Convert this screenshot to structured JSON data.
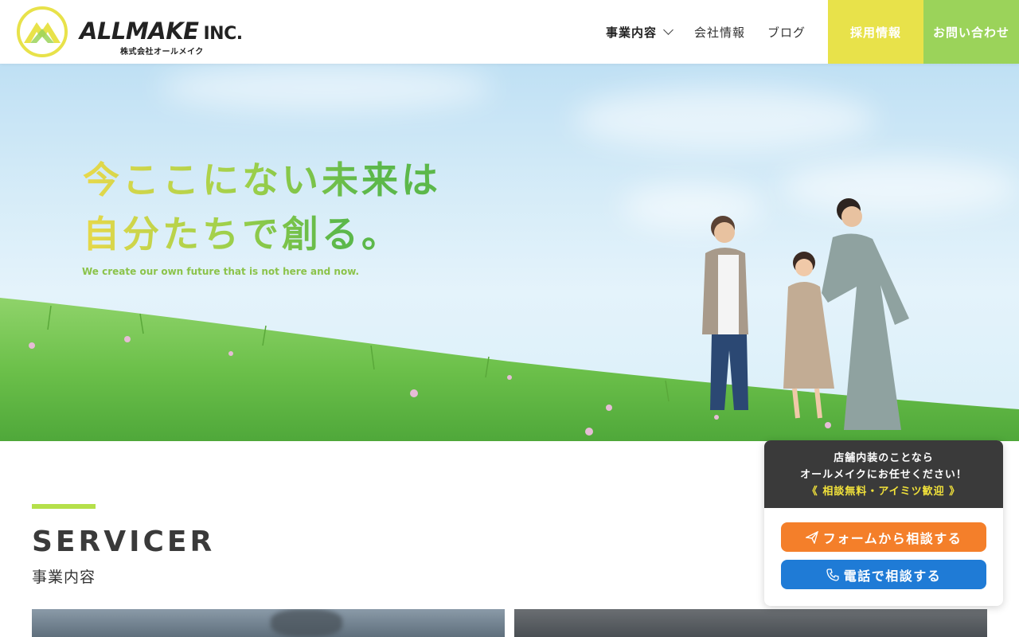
{
  "header": {
    "logo_word": "ALLMAKE",
    "logo_inc": "INC.",
    "logo_sub": "株式会社オールメイク",
    "nav": {
      "services": "事業内容",
      "company": "会社情報",
      "blog": "ブログ",
      "recruit": "採用情報",
      "contact": "お問い合わせ"
    }
  },
  "hero": {
    "title_line1": "今ここにない未来は",
    "title_line2": "自分たちで創る。",
    "subtitle": "We create our own future that is not here and now."
  },
  "services": {
    "title": "SERVICER",
    "subtitle": "事業内容"
  },
  "widget": {
    "line1": "店舗内装のことなら",
    "line2": "オールメイクにお任せください！",
    "line3": "《 相談無料・アイミツ歓迎 》",
    "form_button": "フォームから相談する",
    "tel_button": "電話で相談する"
  },
  "colors": {
    "accent_yellow": "#e8e24a",
    "accent_green": "#9bd35a",
    "form_orange": "#f47f2a",
    "tel_blue": "#1f7bd6"
  },
  "icons": {
    "logo": "allmake-logo-mark",
    "nav_chevron": "chevron-down-icon",
    "form": "paper-plane-icon",
    "tel": "phone-icon"
  }
}
